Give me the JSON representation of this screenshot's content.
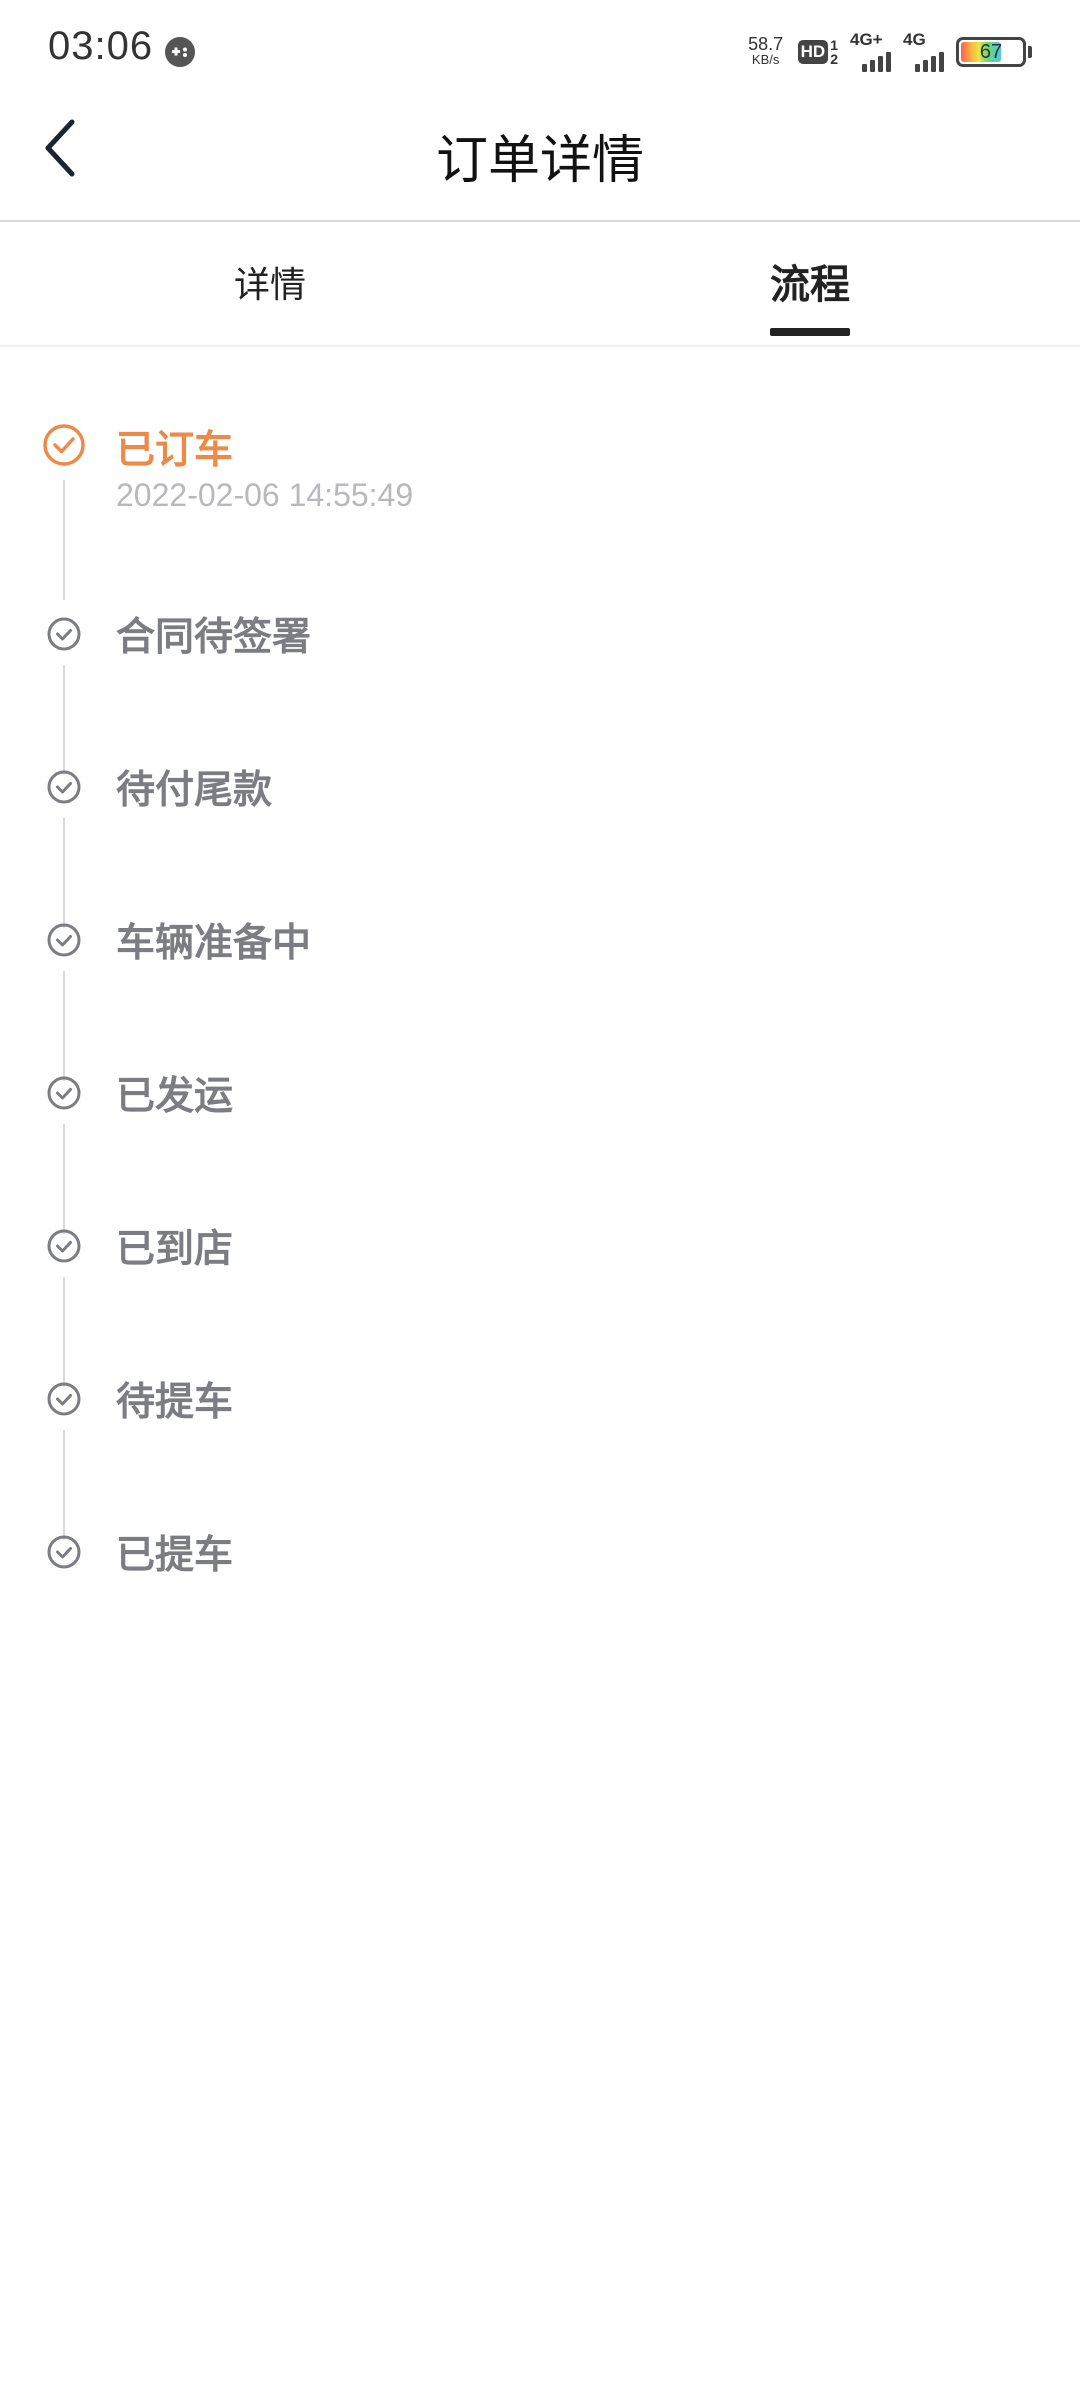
{
  "status_bar": {
    "time": "03:06",
    "net_speed_value": "58.7",
    "net_speed_unit": "KB/s",
    "hd_label": "HD",
    "hd_top": "1",
    "hd_bottom": "2",
    "signal1_label": "4G+",
    "signal2_label": "4G",
    "battery_level": "67",
    "icons": [
      "gamepad-icon",
      "hd-icon",
      "signal-icon",
      "battery-icon"
    ]
  },
  "header": {
    "title": "订单详情",
    "back_icon": "chevron-left-icon"
  },
  "tabs": [
    {
      "label": "详情",
      "active": false
    },
    {
      "label": "流程",
      "active": true
    }
  ],
  "timeline": {
    "accent_color": "#ee8a48",
    "inactive_color": "#7c7d82",
    "steps": [
      {
        "label": "已订车",
        "time": "2022-02-06 14:55:49",
        "current": true
      },
      {
        "label": "合同待签署",
        "current": false
      },
      {
        "label": "待付尾款",
        "current": false
      },
      {
        "label": "车辆准备中",
        "current": false
      },
      {
        "label": "已发运",
        "current": false
      },
      {
        "label": "已到店",
        "current": false
      },
      {
        "label": "待提车",
        "current": false
      },
      {
        "label": "已提车",
        "current": false
      }
    ]
  }
}
